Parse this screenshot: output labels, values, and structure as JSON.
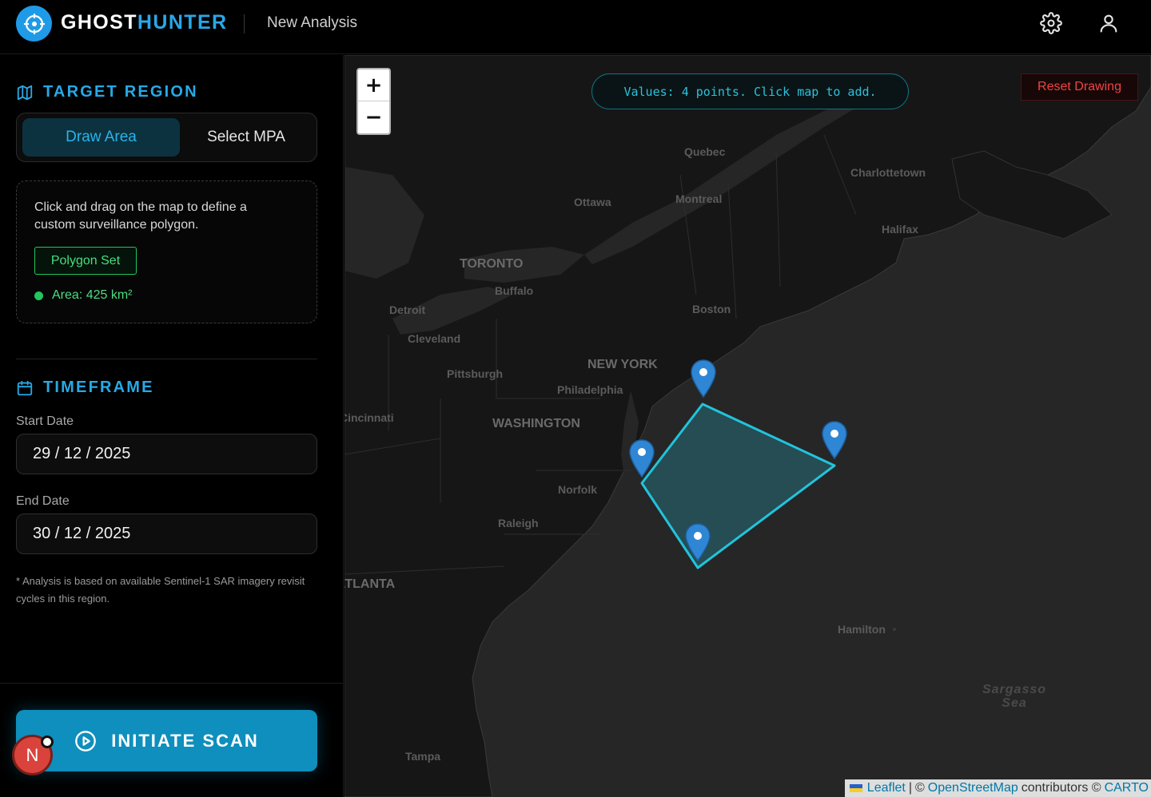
{
  "header": {
    "brand_part1": "GHOST",
    "brand_part2": "HUNTER",
    "page_subtitle": "New Analysis",
    "icons": [
      "crosshair-logo-icon",
      "settings-gear-icon",
      "user-profile-icon"
    ]
  },
  "sidebar": {
    "target_region": {
      "title": "TARGET REGION",
      "icon": "map-icon",
      "tabs": [
        {
          "label": "Draw Area",
          "active": true
        },
        {
          "label": "Select MPA",
          "active": false
        }
      ],
      "instructions": "Click and drag on the map to define a custom surveillance polygon.",
      "status_badge": "Polygon Set",
      "area_text": "Area: 425 km²"
    },
    "timeframe": {
      "title": "TIMEFRAME",
      "icon": "calendar-icon",
      "start_label": "Start Date",
      "start_value": "29 / 12 / 2025",
      "end_label": "End Date",
      "end_value": "30 / 12 / 2025",
      "footnote": "* Analysis is based on available Sentinel-1 SAR imagery revisit cycles in this region."
    },
    "scan_button": "INITIATE SCAN",
    "avatar_letter": "N"
  },
  "map": {
    "zoom_in": "+",
    "zoom_out": "−",
    "values_text": "Values: 4 points. Click map to add.",
    "reset_label": "Reset Drawing",
    "cities": [
      "Quebec",
      "Charlottetown",
      "Ottawa",
      "Montreal",
      "Halifax",
      "TORONTO",
      "Buffalo",
      "Detroit",
      "Boston",
      "Cleveland",
      "NEW YORK",
      "Pittsburgh",
      "Philadelphia",
      "Cincinnati",
      "WASHINGTON",
      "Norfolk",
      "Raleigh",
      "ATLANTA",
      "Hamilton",
      "Tampa"
    ],
    "sea_label": "Sargasso Sea",
    "attribution": {
      "leaflet": "Leaflet",
      "sep": "|",
      "osm_prefix": "©",
      "osm": "OpenStreetMap",
      "contrib": "contributors ©",
      "carto": "CARTO"
    },
    "polygon_point_count": 4,
    "accent_color": "#22c3dc"
  }
}
